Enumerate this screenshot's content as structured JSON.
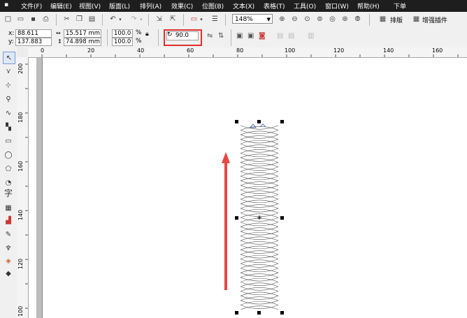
{
  "menu": {
    "items": [
      "文件(F)",
      "编辑(E)",
      "视图(V)",
      "版面(L)",
      "排列(A)",
      "效果(C)",
      "位图(B)",
      "文本(X)",
      "表格(T)",
      "工具(O)",
      "窗口(W)",
      "帮助(H)",
      "下单"
    ]
  },
  "toolbar": {
    "zoom_value": "148%",
    "layout_label": "排版",
    "plugin_label": "增强插件"
  },
  "property_bar": {
    "x_label": "x:",
    "x_value": "88.611 mm",
    "y_label": "y:",
    "y_value": "137.883 mm",
    "width_value": "15.517 mm",
    "height_value": "74.898 mm",
    "scale_x": "100.0",
    "scale_y": "100.0",
    "percent": "%",
    "rotation": "90.0"
  },
  "ruler": {
    "h_labels": [
      "0",
      "20",
      "40",
      "60",
      "80",
      "100",
      "120",
      "140",
      "160"
    ],
    "v_labels": [
      "200",
      "180",
      "160",
      "140",
      "120",
      "100"
    ]
  },
  "colors": {
    "menubar": "#1e1e1e",
    "highlight": "#e03030",
    "arrow": "#e84545"
  }
}
